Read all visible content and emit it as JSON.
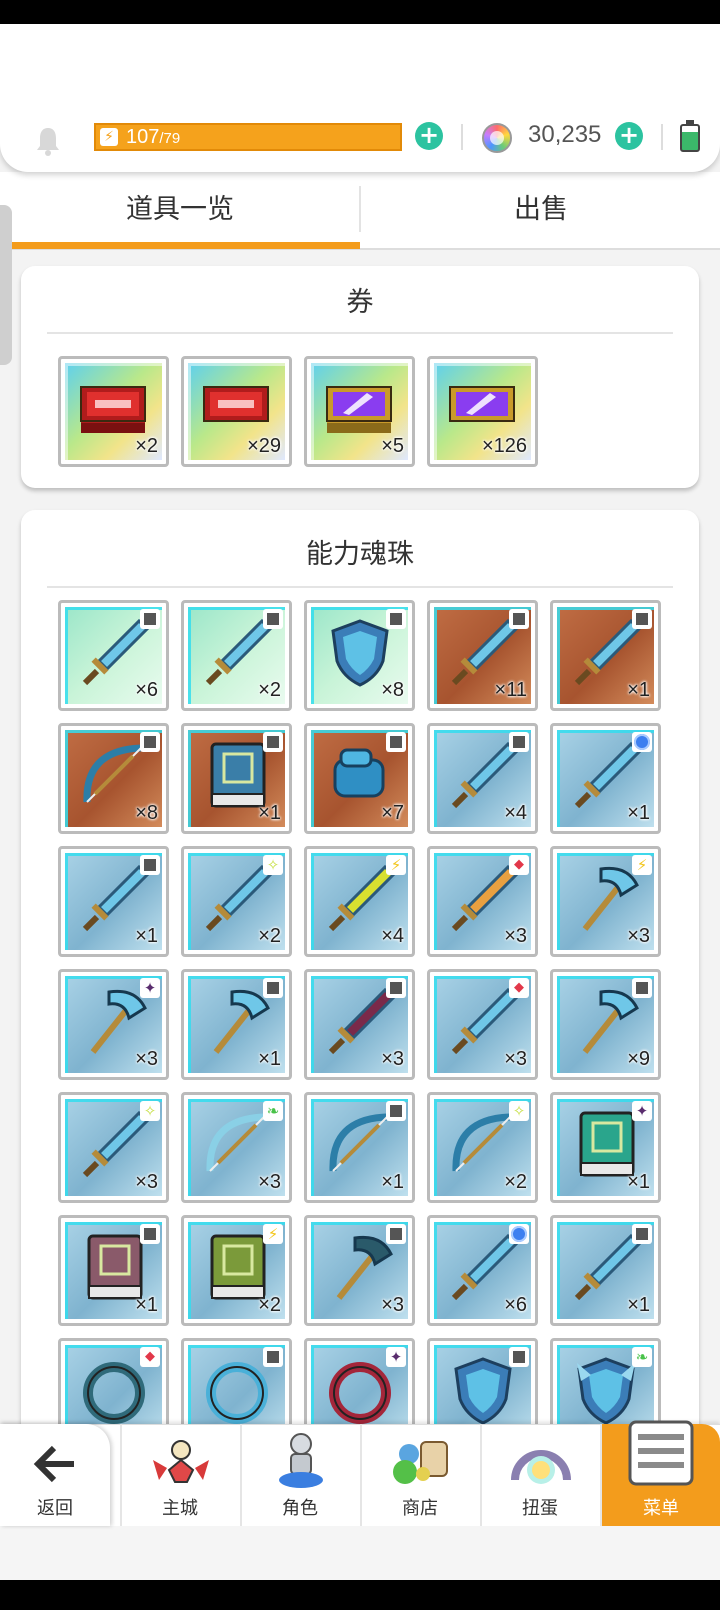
{
  "status": {
    "energy_current": "107",
    "energy_max": "/79",
    "gems": "30,235",
    "colors": {
      "energy": "#f5a21c",
      "plus": "#2cc3a0",
      "accent": "#f39c1c"
    }
  },
  "tabs": [
    {
      "label": "道具一览",
      "active": true
    },
    {
      "label": "出售",
      "active": false
    }
  ],
  "tickets": {
    "title": "券",
    "items": [
      {
        "icon": "red-ticket-stack-icon",
        "count": "×2",
        "bg": "bg-ticket"
      },
      {
        "icon": "red-ticket-icon",
        "count": "×29",
        "bg": "bg-ticket"
      },
      {
        "icon": "purple-crystal-ticket-stack-icon",
        "count": "×5",
        "bg": "bg-ticket"
      },
      {
        "icon": "purple-crystal-ticket-icon",
        "count": "×126",
        "bg": "bg-ticket"
      }
    ]
  },
  "souls": {
    "title": "能力魂珠",
    "items": [
      {
        "icon": "dagger-icon",
        "count": "×6",
        "bg": "bg-green",
        "rank": "r-gray"
      },
      {
        "icon": "staff-icon",
        "count": "×2",
        "bg": "bg-green",
        "rank": "r-gray"
      },
      {
        "icon": "shield-icon",
        "count": "×8",
        "bg": "bg-green",
        "rank": "r-gray"
      },
      {
        "icon": "sword-icon",
        "count": "×11",
        "bg": "bg-brown",
        "rank": "r-gray"
      },
      {
        "icon": "spear-icon",
        "count": "×1",
        "bg": "bg-brown",
        "rank": "r-gray"
      },
      {
        "icon": "crossbow-icon",
        "count": "×8",
        "bg": "bg-brown",
        "rank": "r-gray"
      },
      {
        "icon": "tome-icon",
        "count": "×1",
        "bg": "bg-brown",
        "rank": "r-gray"
      },
      {
        "icon": "gauntlet-icon",
        "count": "×7",
        "bg": "bg-brown",
        "rank": "r-gray"
      },
      {
        "icon": "broadsword-icon",
        "count": "×4",
        "bg": "bg-blue",
        "rank": "r-gray"
      },
      {
        "icon": "knife-icon",
        "count": "×1",
        "bg": "bg-blue",
        "rank": "r-blue"
      },
      {
        "icon": "curved-blade-icon",
        "count": "×1",
        "bg": "bg-blue",
        "rank": "r-gray"
      },
      {
        "icon": "short-sword-icon",
        "count": "×2",
        "bg": "bg-blue",
        "rank": "r-star"
      },
      {
        "icon": "lightning-sword-icon",
        "count": "×4",
        "bg": "bg-blue",
        "rank": "r-yellow"
      },
      {
        "icon": "fire-sword-icon",
        "count": "×3",
        "bg": "bg-blue",
        "rank": "r-red"
      },
      {
        "icon": "pickaxe-icon",
        "count": "×3",
        "bg": "bg-blue",
        "rank": "r-yellow"
      },
      {
        "icon": "battle-axe-icon",
        "count": "×3",
        "bg": "bg-blue",
        "rank": "r-purple"
      },
      {
        "icon": "axe-icon",
        "count": "×1",
        "bg": "bg-blue",
        "rank": "r-gray"
      },
      {
        "icon": "dark-spear-icon",
        "count": "×3",
        "bg": "bg-blue",
        "rank": "r-gray"
      },
      {
        "icon": "lance-icon",
        "count": "×3",
        "bg": "bg-blue",
        "rank": "r-red"
      },
      {
        "icon": "scythe-icon",
        "count": "×9",
        "bg": "bg-blue",
        "rank": "r-gray"
      },
      {
        "icon": "thin-sword-icon",
        "count": "×3",
        "bg": "bg-blue",
        "rank": "r-star"
      },
      {
        "icon": "bow-icon",
        "count": "×3",
        "bg": "bg-blue",
        "rank": "r-green"
      },
      {
        "icon": "light-crossbow-icon",
        "count": "×1",
        "bg": "bg-blue",
        "rank": "r-gray"
      },
      {
        "icon": "heavy-crossbow-icon",
        "count": "×2",
        "bg": "bg-blue",
        "rank": "r-star"
      },
      {
        "icon": "rune-book-icon",
        "count": "×1",
        "bg": "bg-blue",
        "rank": "r-purple"
      },
      {
        "icon": "spell-book-icon",
        "count": "×1",
        "bg": "bg-blue",
        "rank": "r-gray"
      },
      {
        "icon": "green-book-icon",
        "count": "×2",
        "bg": "bg-blue",
        "rank": "r-yellow"
      },
      {
        "icon": "dark-pickaxe-icon",
        "count": "×3",
        "bg": "bg-blue",
        "rank": "r-gray"
      },
      {
        "icon": "orb-staff-icon",
        "count": "×6",
        "bg": "bg-blue",
        "rank": "r-blue"
      },
      {
        "icon": "scepter-icon",
        "count": "×1",
        "bg": "bg-blue",
        "rank": "r-gray"
      },
      {
        "icon": "chakram-icon",
        "count": "",
        "bg": "bg-blue",
        "rank": "r-red"
      },
      {
        "icon": "saw-blade-icon",
        "count": "",
        "bg": "bg-blue",
        "rank": "r-gray"
      },
      {
        "icon": "chain-icon",
        "count": "",
        "bg": "bg-blue",
        "rank": "r-purple"
      },
      {
        "icon": "round-shield-icon",
        "count": "",
        "bg": "bg-blue",
        "rank": "r-gray"
      },
      {
        "icon": "winged-shield-icon",
        "count": "",
        "bg": "bg-blue",
        "rank": "r-green"
      }
    ]
  },
  "nav": {
    "back": "返回",
    "items": [
      {
        "label": "主城",
        "icon": "castle-icon",
        "active": false
      },
      {
        "label": "角色",
        "icon": "character-icon",
        "active": false
      },
      {
        "label": "商店",
        "icon": "shop-icon",
        "active": false
      },
      {
        "label": "扭蛋",
        "icon": "gacha-icon",
        "active": false
      },
      {
        "label": "菜单",
        "icon": "menu-icon",
        "active": true
      }
    ]
  }
}
